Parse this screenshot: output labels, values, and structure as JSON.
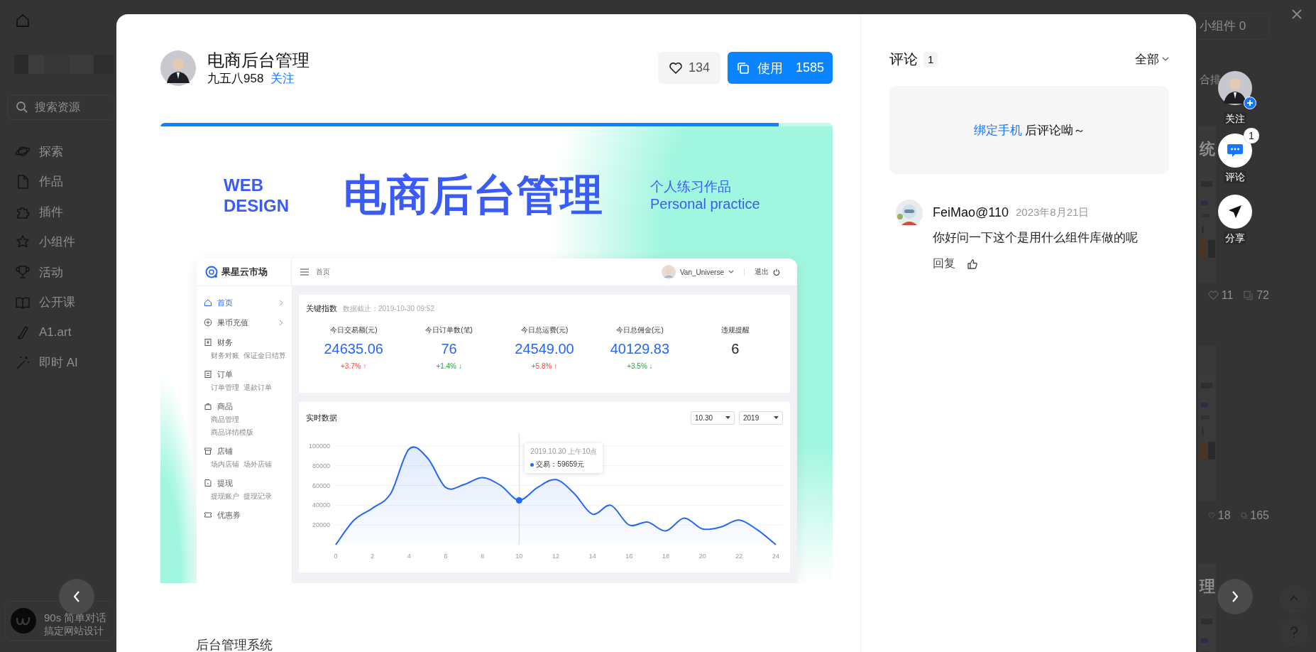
{
  "bg_page": {
    "sidebar": {
      "search": {
        "placeholder": "搜索资源"
      },
      "items": [
        {
          "label": "探索"
        },
        {
          "label": "作品"
        },
        {
          "label": "插件"
        },
        {
          "label": "小组件"
        },
        {
          "label": "活动"
        },
        {
          "label": "公开课"
        },
        {
          "label": "A1.art"
        },
        {
          "label": "即时 AI"
        }
      ]
    },
    "promo": {
      "title": "90s 简单对话",
      "subtitle": "搞定网站设计"
    },
    "right": {
      "tab": "小组件 0",
      "sort": "合排",
      "cards": [
        {
          "title": "统",
          "likes": "11",
          "copies": "72"
        },
        {
          "likes": "18",
          "copies": "165"
        },
        {
          "title": "理"
        }
      ]
    }
  },
  "modal": {
    "work": {
      "title": "电商后台管理",
      "author": "九五八958",
      "follow": "关注",
      "likes": "134",
      "use_label": "使用",
      "use_count": "1585"
    },
    "banner": {
      "level": 0.92,
      "tag_lines": [
        "WEB",
        "DESIGN"
      ],
      "title": "电商后台管理",
      "subtitle": "个人练习作品",
      "subtitle_en": "Personal practice",
      "dashboard": {
        "logo": "果星云市场",
        "breadcrumb": "首页",
        "user": "Van_Universe",
        "logout": "退出",
        "nav": [
          {
            "label": "首页",
            "selected": true,
            "chevron": true
          },
          {
            "label": "果币充值",
            "selected": false,
            "chevron": true
          },
          {
            "label": "财务",
            "selected": false,
            "chevron": false,
            "stacked": false,
            "children": [
              {
                "label": "财务对账"
              },
              {
                "label": "保证金日结算"
              }
            ]
          },
          {
            "label": "订单",
            "selected": false,
            "chevron": false,
            "stacked": false,
            "children": [
              {
                "label": "订单管理"
              },
              {
                "label": "退款订单"
              }
            ]
          },
          {
            "label": "商品",
            "selected": false,
            "chevron": false,
            "stacked": true,
            "children": [
              {
                "label": "商品管理"
              },
              {
                "label": "商品详情模版"
              }
            ]
          },
          {
            "label": "店铺",
            "selected": false,
            "chevron": false,
            "stacked": false,
            "children": [
              {
                "label": "场内店铺"
              },
              {
                "label": "场外店铺"
              }
            ]
          },
          {
            "label": "提现",
            "selected": false,
            "chevron": false,
            "stacked": false,
            "children": [
              {
                "label": "提现账户"
              },
              {
                "label": "提现记录"
              }
            ]
          },
          {
            "label": "优惠券",
            "selected": false,
            "chevron": false
          }
        ],
        "key_metrics": {
          "title": "关键指数",
          "updated": "数据截止：2019-10-30 09:52",
          "items": [
            {
              "label": "今日交易额(元)",
              "value": "24635.06",
              "change": "+3.7% ↑",
              "color": "#f5483b"
            },
            {
              "label": "今日订单数(笔)",
              "value": "76",
              "change": "+1.4% ↓",
              "color": "#22a447"
            },
            {
              "label": "今日总运费(元)",
              "value": "24549.00",
              "change": "+5.8% ↑",
              "color": "#f5483b"
            },
            {
              "label": "今日总佣金(元)",
              "value": "40129.83",
              "change": "+3.5% ↓",
              "color": "#22a447"
            },
            {
              "label": "违规提醒",
              "value": "6"
            }
          ]
        },
        "realtime": {
          "title": "实时数据",
          "date": "10.30",
          "year": "2019",
          "chart_data": {
            "type": "area",
            "x": [
              0,
              1,
              2,
              3,
              4,
              5,
              6,
              7,
              8,
              9,
              10,
              11,
              12,
              13,
              14,
              15,
              16,
              17,
              18,
              19,
              20,
              21,
              22,
              23,
              24
            ],
            "series": [
              {
                "color": "#2468f2",
                "values": [
                  0,
                  25000,
                  37000,
                  52000,
                  97000,
                  88000,
                  58000,
                  61000,
                  68000,
                  60000,
                  45000,
                  58000,
                  66000,
                  52000,
                  31000,
                  40000,
                  20000,
                  23000,
                  14000,
                  27000,
                  16000,
                  18000,
                  25000,
                  15000,
                  0
                ]
              }
            ],
            "xlim": [
              0,
              24
            ],
            "ylim": [
              0,
              100000
            ],
            "xticks": [
              0,
              2,
              4,
              6,
              8,
              10,
              12,
              14,
              16,
              18,
              20,
              22,
              24
            ],
            "yticks": [
              20000,
              40000,
              60000,
              80000,
              100000
            ],
            "grid": true,
            "ref_lines": [
              {
                "axis": "x",
                "value": 10
              }
            ],
            "annotations": [
              "2019.10.30 上午10点",
              "交易：59659元"
            ]
          }
        }
      }
    },
    "description": "后台管理系统",
    "comments": {
      "title": "评论",
      "count": "1",
      "filter": "全部",
      "prompt": {
        "link": "绑定手机",
        "text": "后评论呦～"
      },
      "items": [
        {
          "user": "FeiMao@110",
          "date": "2023年8月21日",
          "text": "你好问一下这个是用什么组件库做的呢",
          "reply": "回复"
        }
      ]
    }
  },
  "actions": [
    {
      "kind": "follow",
      "label": "关注"
    },
    {
      "kind": "comment",
      "label": "评论",
      "badge": "1"
    },
    {
      "kind": "share",
      "label": "分享"
    }
  ]
}
